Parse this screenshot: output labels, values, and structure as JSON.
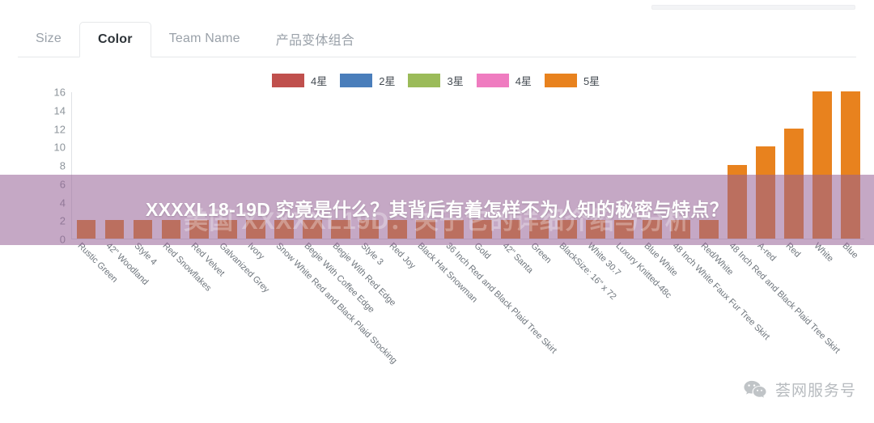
{
  "tabs": [
    {
      "label": "Size",
      "active": false
    },
    {
      "label": "Color",
      "active": true
    },
    {
      "label": "Team Name",
      "active": false
    },
    {
      "label": "产品变体组合",
      "active": false
    }
  ],
  "overlay": {
    "title": "XXXXL18-19D 究竟是什么？其背后有着怎样不为人知的秘密与特点？",
    "ghost_text": "美国 XXXXXL19D：关于它的详细介绍与分析",
    "background_color": "#966196"
  },
  "watermark": {
    "icon": "wechat-icon",
    "text": "荟网服务号"
  },
  "chart_data": {
    "type": "bar",
    "title": "",
    "xlabel": "",
    "ylabel": "",
    "ylim": [
      0,
      16
    ],
    "grid": false,
    "legend_position": "top-center",
    "legend": [
      {
        "label": "4星",
        "color": "#c0504d"
      },
      {
        "label": "2星",
        "color": "#4a7ebb"
      },
      {
        "label": "3星",
        "color": "#9bbb59"
      },
      {
        "label": "4星",
        "color": "#ef7cc0"
      },
      {
        "label": "5星",
        "color": "#e8821e"
      }
    ],
    "yticks": [
      16,
      14,
      12,
      10,
      8,
      6,
      4,
      2,
      0
    ],
    "categories": [
      "Rustic Green",
      "42\" Woodland",
      "Style 4",
      "Red Snowflakes",
      "Red Velvet",
      "Galvanized Grey",
      "Ivory",
      "Snow White Red and Black Plaid Stocking",
      "Begie With Coffee Edge",
      "Begie With Red Edge",
      "Style 3",
      "Red Joy",
      "Black Hat Snowman",
      "36 Inch Red and Black Plaid Tree Skirt",
      "Gold",
      "42\" Santa",
      "Green",
      "BlackSize: 16\" x 72",
      "White 30.7",
      "Luxury Knitted-48c",
      "Blue White",
      "48 Inch White Faux Fur Tree Skirt",
      "Red/White",
      "48 Inch Red and Black Plaid Tree Skirt",
      "A-red",
      "Red",
      "White",
      "Blue"
    ],
    "values": [
      2,
      2,
      2,
      2,
      2,
      2,
      2,
      2,
      2,
      2,
      2,
      2,
      2,
      2,
      2,
      2,
      2,
      2,
      2,
      2,
      2,
      2,
      2,
      8,
      10,
      12,
      16,
      16
    ],
    "bar_colors": [
      "#e8821e",
      "#e8821e",
      "#e8821e",
      "#e8821e",
      "#e8821e",
      "#e8821e",
      "#e8821e",
      "#e8821e",
      "#e8821e",
      "#e8821e",
      "#e8821e",
      "#e8821e",
      "#e8821e",
      "#e8821e",
      "#e8821e",
      "#e8821e",
      "#e8821e",
      "#e8821e",
      "#e8821e",
      "#e8821e",
      "#e8821e",
      "#e8821e",
      "#e8821e",
      "#e8821e",
      "#e8821e",
      "#e8821e",
      "#e8821e",
      "#e8821e"
    ]
  }
}
